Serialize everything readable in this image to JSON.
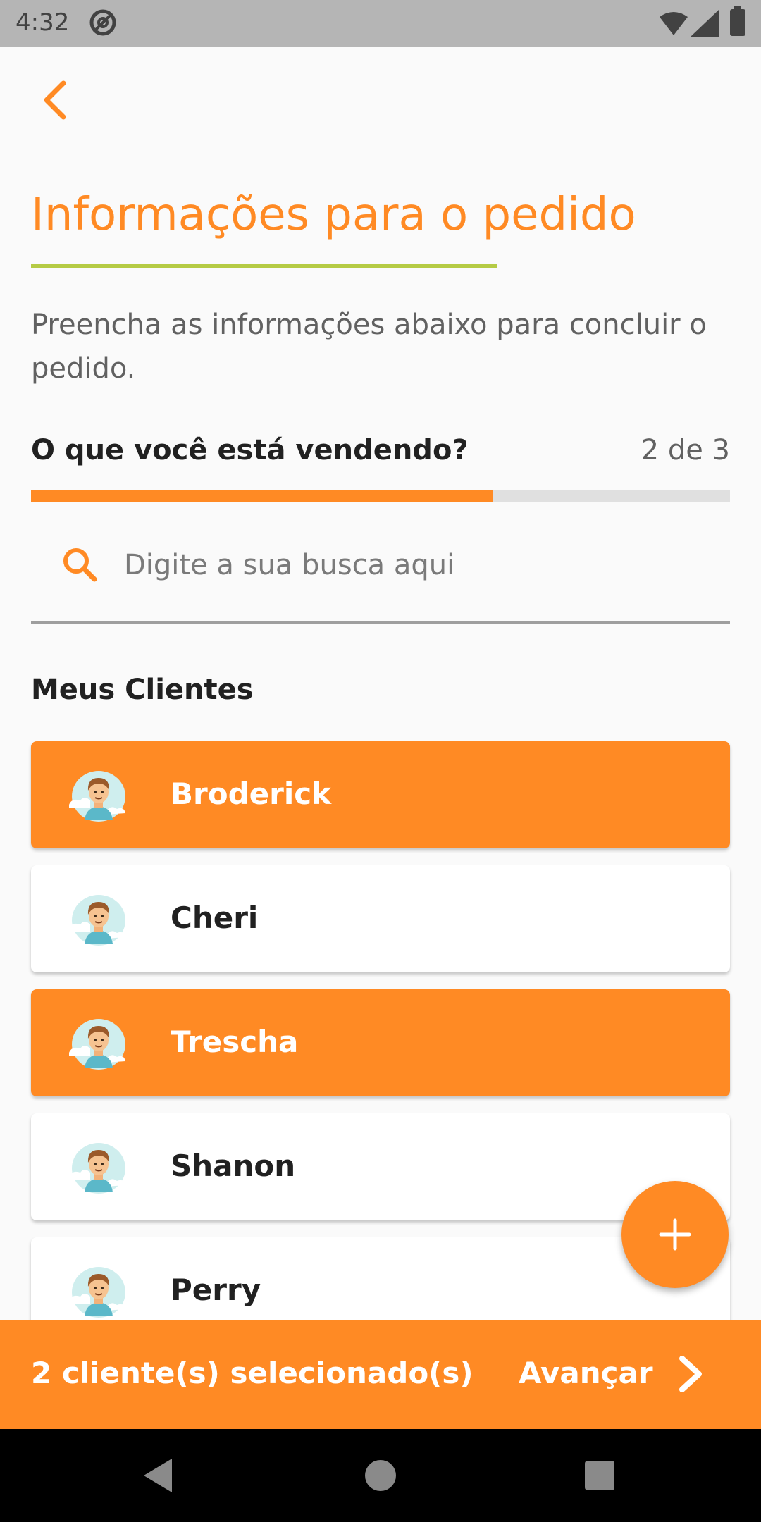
{
  "status_bar": {
    "time": "4:32",
    "icons": [
      "at-sign-icon",
      "wifi-icon",
      "signal-icon",
      "battery-icon"
    ]
  },
  "header": {
    "back_icon": "chevron-left-icon",
    "title": "Informações para o pedido",
    "description": "Preencha as informações abaixo para concluir o pedido."
  },
  "step": {
    "question": "O que você está vendendo?",
    "counter": "2 de 3",
    "progress_fraction": 0.66
  },
  "search": {
    "icon": "search-icon",
    "placeholder": "Digite a sua busca aqui",
    "value": ""
  },
  "clients": {
    "section_title": "Meus Clientes",
    "items": [
      {
        "name": "Broderick",
        "selected": true
      },
      {
        "name": "Cheri",
        "selected": false
      },
      {
        "name": "Trescha",
        "selected": true
      },
      {
        "name": "Shanon",
        "selected": false
      },
      {
        "name": "Perry",
        "selected": false
      }
    ]
  },
  "fab": {
    "icon": "plus-icon"
  },
  "bottom_bar": {
    "selected_count_text": "2 cliente(s) selecionado(s)",
    "advance_label": "Avançar",
    "advance_icon": "chevron-right-icon"
  },
  "nav_bar": {
    "icons": [
      "back-triangle-icon",
      "home-circle-icon",
      "recent-square-icon"
    ]
  },
  "colors": {
    "accent": "#ff8a24",
    "underline": "#b5cb45",
    "progress_track": "#e0e0e0",
    "card": "#ffffff",
    "status_bar": "#b5b5b5"
  }
}
